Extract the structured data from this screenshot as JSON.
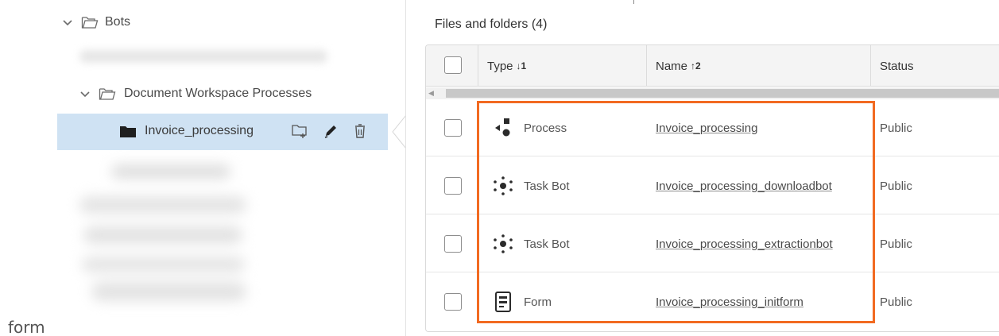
{
  "tree": {
    "bots_label": "Bots",
    "dwp_label": "Document Workspace Processes",
    "selected_label": "Invoice_processing"
  },
  "stray_text": "form",
  "files": {
    "title": "Files and folders (4)",
    "columns": [
      {
        "label": "Type",
        "sort": "↓1"
      },
      {
        "label": "Name",
        "sort": "↑2"
      },
      {
        "label": "Status",
        "sort": ""
      }
    ],
    "rows": [
      {
        "type": "Process",
        "icon": "process-icon",
        "name": "Invoice_processing",
        "status": "Public"
      },
      {
        "type": "Task Bot",
        "icon": "taskbot-icon",
        "name": "Invoice_processing_downloadbot",
        "status": "Public"
      },
      {
        "type": "Task Bot",
        "icon": "taskbot-icon",
        "name": "Invoice_processing_extractionbot",
        "status": "Public"
      },
      {
        "type": "Form",
        "icon": "form-icon",
        "name": "Invoice_processing_initform",
        "status": "Public"
      }
    ]
  },
  "colors": {
    "selection": "#cfe2f3",
    "highlight": "#f26a21",
    "header_bg": "#f4f4f4"
  }
}
